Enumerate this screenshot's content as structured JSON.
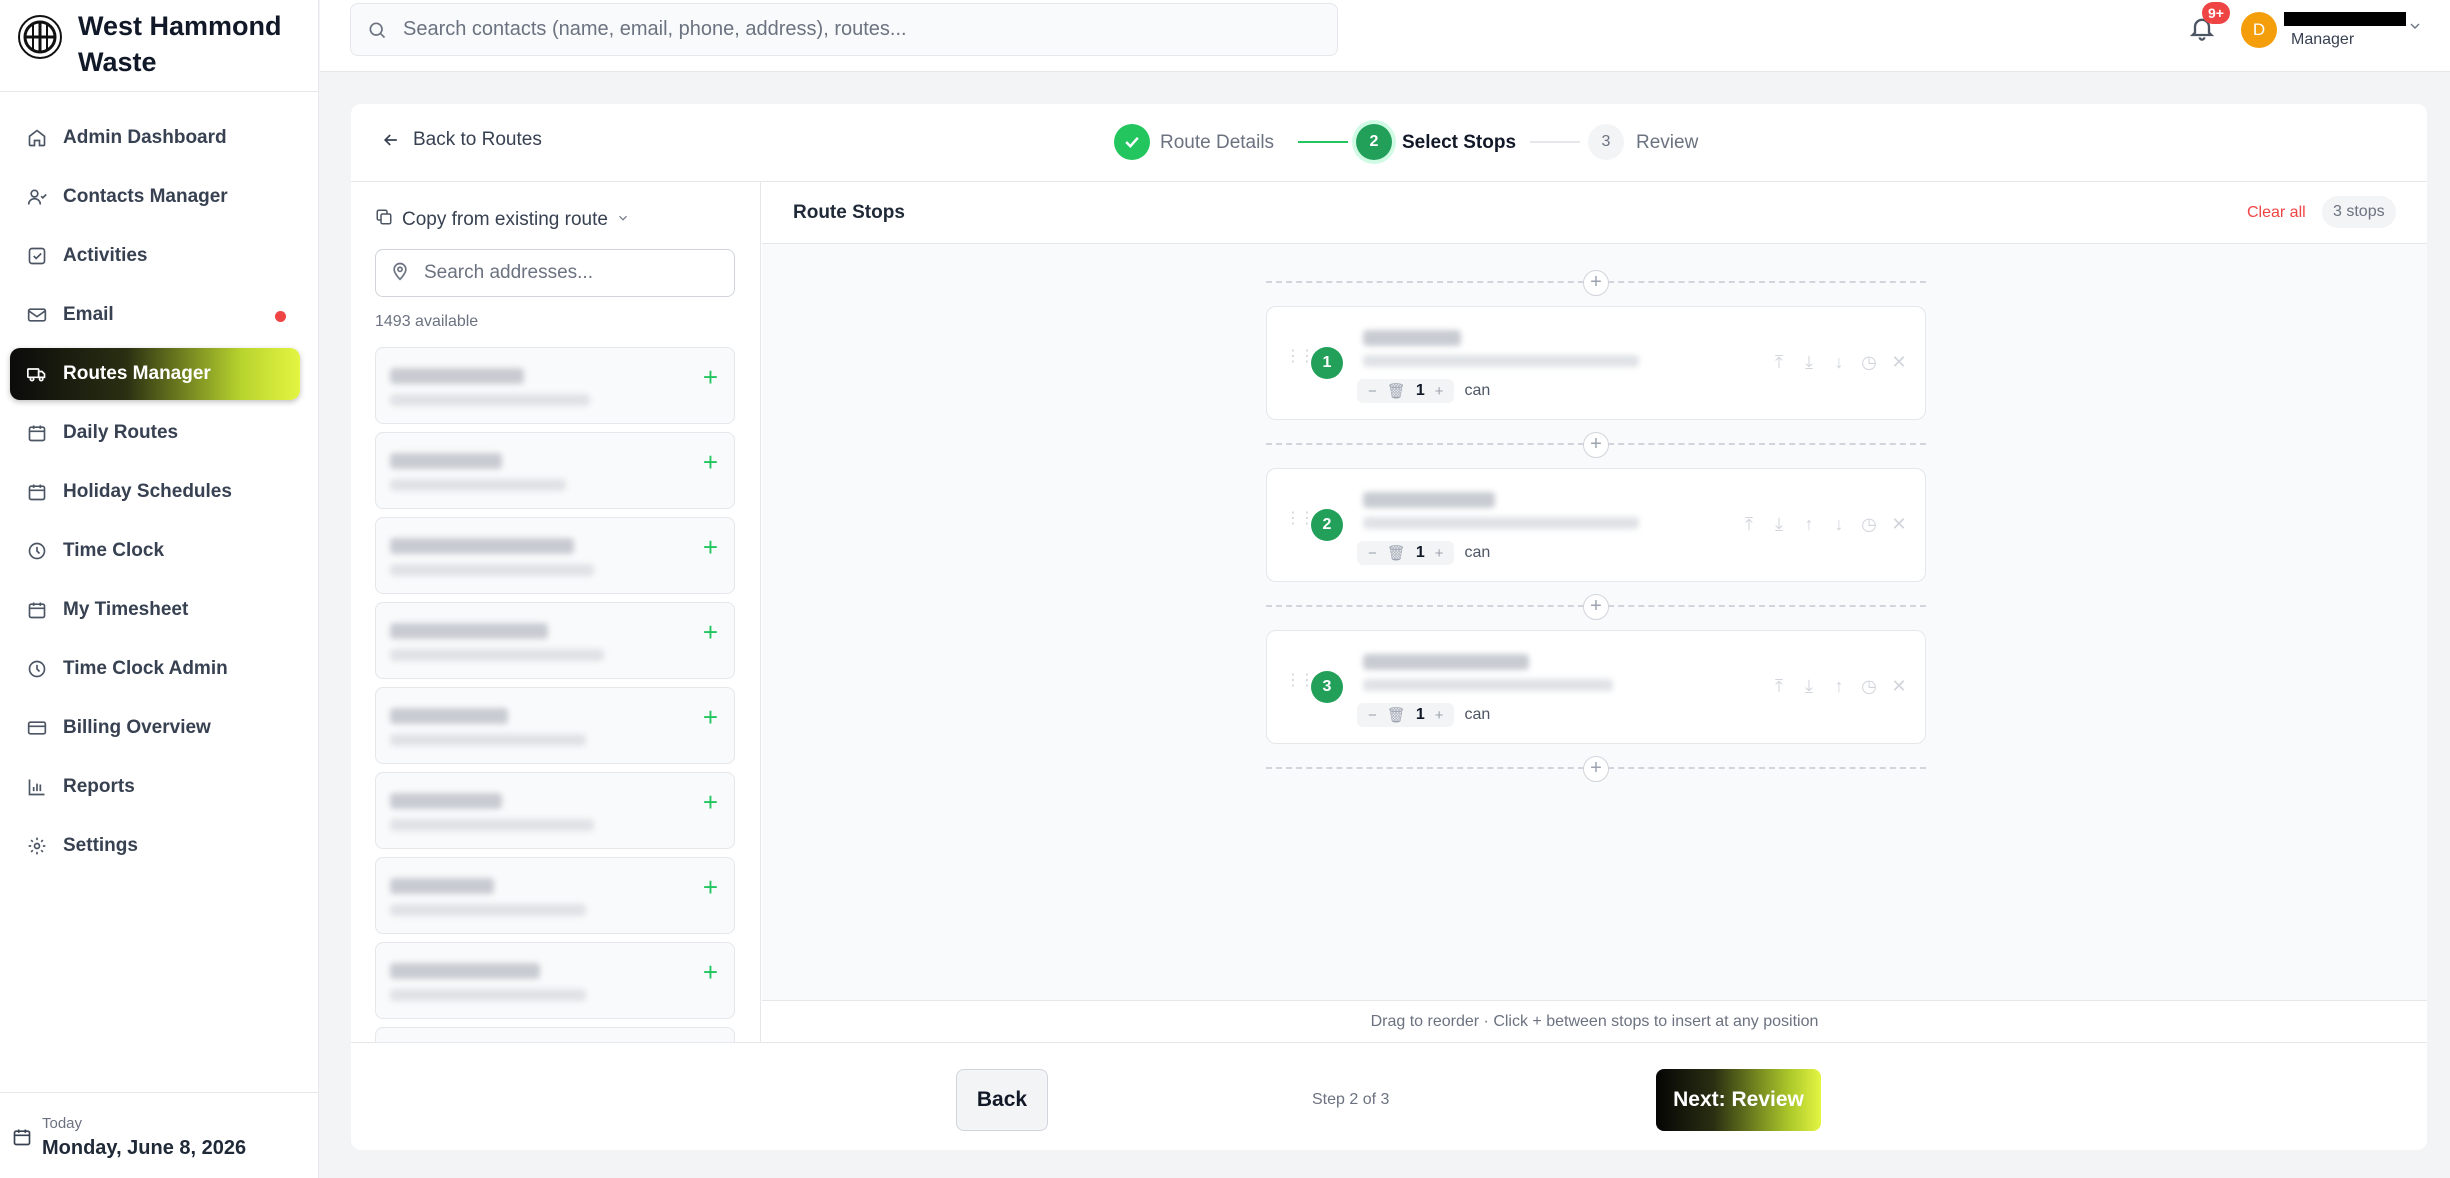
{
  "brand": {
    "name": "West Hammond Waste"
  },
  "sidebar": {
    "items": [
      {
        "label": "Admin Dashboard",
        "icon": "home-icon"
      },
      {
        "label": "Contacts Manager",
        "icon": "user-icon"
      },
      {
        "label": "Activities",
        "icon": "checkbox-icon"
      },
      {
        "label": "Email",
        "icon": "mail-icon",
        "notification_dot": true
      },
      {
        "label": "Routes Manager",
        "icon": "truck-icon",
        "active": true
      },
      {
        "label": "Daily Routes",
        "icon": "calendar-icon"
      },
      {
        "label": "Holiday Schedules",
        "icon": "calendar-icon"
      },
      {
        "label": "Time Clock",
        "icon": "clock-icon"
      },
      {
        "label": "My Timesheet",
        "icon": "calendar-icon"
      },
      {
        "label": "Time Clock Admin",
        "icon": "clock-icon"
      },
      {
        "label": "Billing Overview",
        "icon": "credit-card-icon"
      },
      {
        "label": "Reports",
        "icon": "bar-chart-icon"
      },
      {
        "label": "Settings",
        "icon": "gear-icon"
      }
    ],
    "today_label": "Today",
    "today_date": "Monday, June 8, 2026"
  },
  "topbar": {
    "search_placeholder": "Search contacts (name, email, phone, address), routes...",
    "notification_badge": "9+",
    "avatar_initial": "D",
    "user_role": "Manager"
  },
  "wizard": {
    "back_label": "Back to Routes",
    "steps": [
      {
        "number": "1",
        "label": "Route Details",
        "state": "complete"
      },
      {
        "number": "2",
        "label": "Select Stops",
        "state": "current"
      },
      {
        "number": "3",
        "label": "Review",
        "state": "upcoming"
      }
    ]
  },
  "address_panel": {
    "copy_label": "Copy from existing route",
    "search_placeholder": "Search addresses...",
    "available": "1493 available",
    "item_count_visible": 8
  },
  "route_stops": {
    "title": "Route Stops",
    "clear_label": "Clear all",
    "count_label": "3 stops",
    "stops": [
      {
        "number": "1",
        "quantity": "1",
        "unit": "can"
      },
      {
        "number": "2",
        "quantity": "1",
        "unit": "can"
      },
      {
        "number": "3",
        "quantity": "1",
        "unit": "can"
      }
    ],
    "hint": "Drag to reorder · Click + between stops to insert at any position"
  },
  "footer": {
    "back_label": "Back",
    "step_text": "Step 2 of 3",
    "next_label": "Next: Review"
  },
  "colors": {
    "accent_green": "#22a05a",
    "danger": "#ef4444",
    "active_gradient_end": "#e4f542"
  }
}
